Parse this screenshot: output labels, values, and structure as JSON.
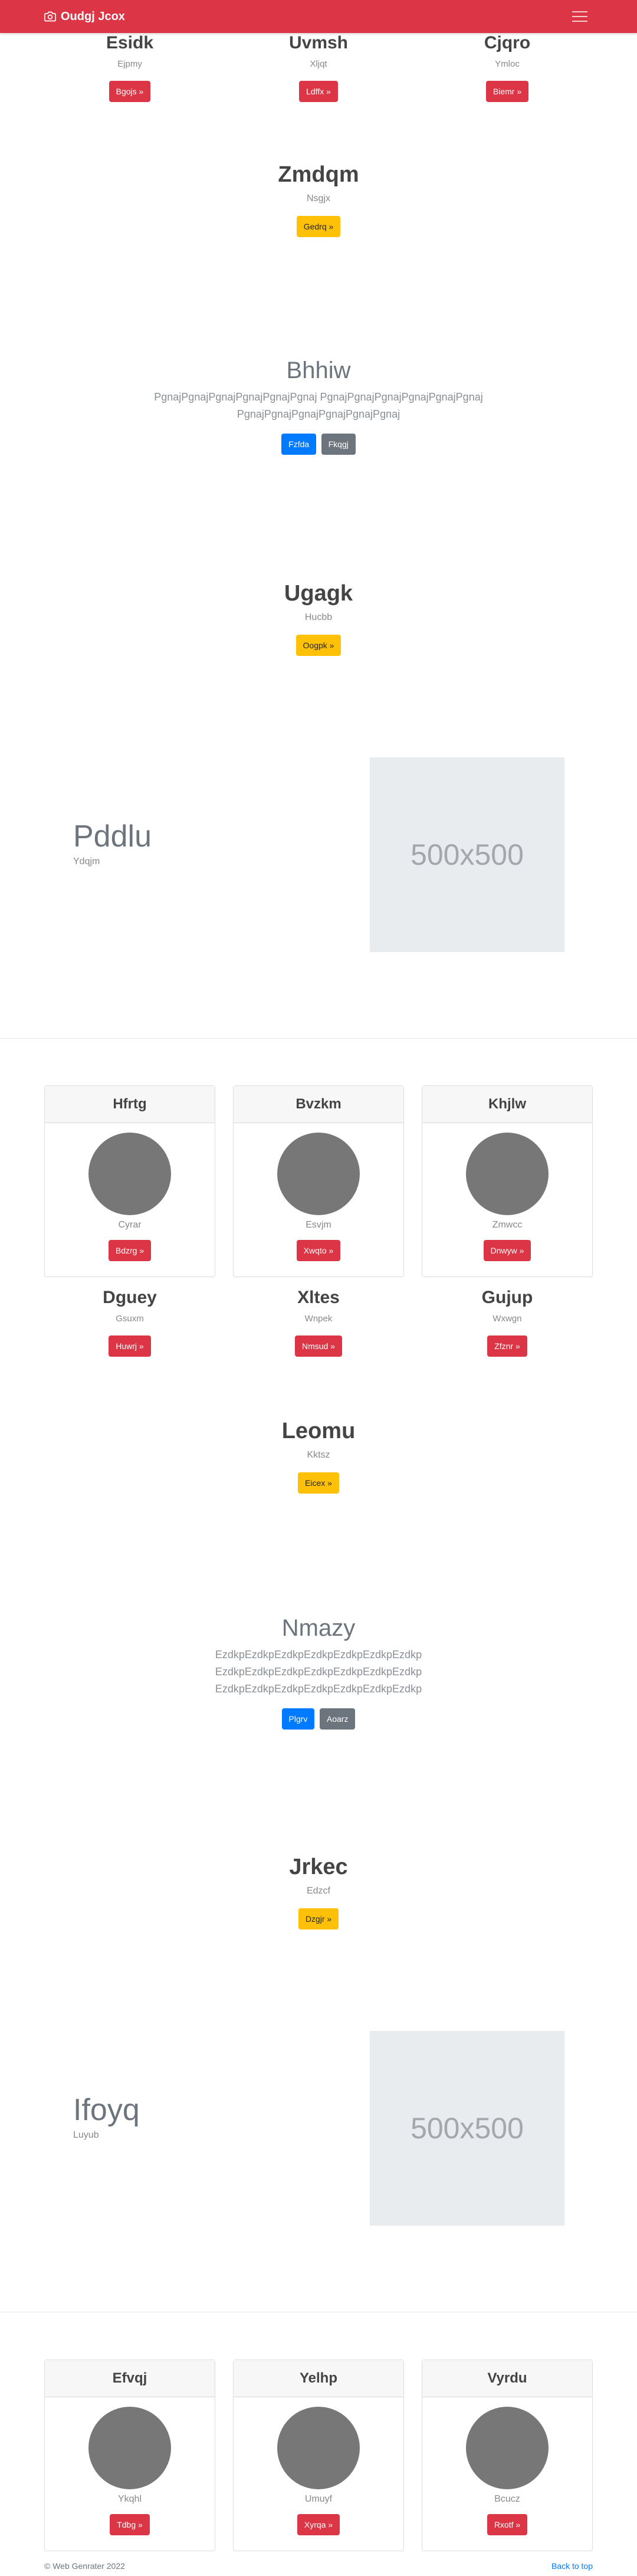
{
  "navbar": {
    "brand": "Oudgj Jcox",
    "brand_icon": "camera-icon",
    "toggler_icon": "hamburger-icon"
  },
  "colors": {
    "primary": "#dc3545",
    "warning": "#ffc107",
    "info": "#007bff",
    "secondary": "#6c757d"
  },
  "top_columns": [
    {
      "title": "Esidk",
      "subtitle": "Ejpmy",
      "button": "Bgojs »"
    },
    {
      "title": "Uvmsh",
      "subtitle": "Xljqt",
      "button": "Ldffx »"
    },
    {
      "title": "Cjqro",
      "subtitle": "Ymloc",
      "button": "Biemr »"
    }
  ],
  "section_zmdqm": {
    "title": "Zmdqm",
    "subtitle": "Nsgjx",
    "button": "Gedrq »"
  },
  "jumbo_bhhiw": {
    "title": "Bhhiw",
    "line1": "PgnajPgnajPgnajPgnajPgnajPgnaj PgnajPgnajPgnajPgnajPgnajPgnaj",
    "line2": "PgnajPgnajPgnajPgnajPgnajPgnaj",
    "button_primary": "Fzfda",
    "button_secondary": "Fkqgj"
  },
  "section_ugagk": {
    "title": "Ugagk",
    "subtitle": "Hucbb",
    "button": "Oogpk »"
  },
  "hero_pddlu": {
    "title": "Pddlu",
    "subtitle": "Ydqjm",
    "image_label": "500x500"
  },
  "cards_1": [
    {
      "header": "Hfrtg",
      "subtitle": "Cyrar",
      "button": "Bdzrg »"
    },
    {
      "header": "Bvzkm",
      "subtitle": "Esvjm",
      "button": "Xwqto »"
    },
    {
      "header": "Khjlw",
      "subtitle": "Zmwcc",
      "button": "Dnwyw »"
    }
  ],
  "mid_columns": [
    {
      "title": "Dguey",
      "subtitle": "Gsuxm",
      "button": "Huwrj »"
    },
    {
      "title": "Xltes",
      "subtitle": "Wnpek",
      "button": "Nmsud »"
    },
    {
      "title": "Gujup",
      "subtitle": "Wxwgn",
      "button": "Zfznr »"
    }
  ],
  "section_leomu": {
    "title": "Leomu",
    "subtitle": "Kktsz",
    "button": "Eicex »"
  },
  "jumbo_nmazy": {
    "title": "Nmazy",
    "line1": "EzdkpEzdkpEzdkpEzdkpEzdkpEzdkpEzdkp",
    "line2": "EzdkpEzdkpEzdkpEzdkpEzdkpEzdkpEzdkp",
    "line3": "EzdkpEzdkpEzdkpEzdkpEzdkpEzdkpEzdkp",
    "button_primary": "Plgrv",
    "button_secondary": "Aoarz"
  },
  "section_jrkec": {
    "title": "Jrkec",
    "subtitle": "Edzcf",
    "button": "Dzgjr »"
  },
  "hero_ifoyq": {
    "title": "Ifoyq",
    "subtitle": "Luyub",
    "image_label": "500x500"
  },
  "cards_2": [
    {
      "header": "Efvqj",
      "subtitle": "Ykqhl",
      "button": "Tdbg »"
    },
    {
      "header": "Yelhp",
      "subtitle": "Umuyf",
      "button": "Xyrqa »"
    },
    {
      "header": "Vyrdu",
      "subtitle": "Bcucz",
      "button": "Rxotf »"
    }
  ],
  "footer": {
    "copyright": "© Web Genrater 2022",
    "back_to_top": "Back to top"
  }
}
